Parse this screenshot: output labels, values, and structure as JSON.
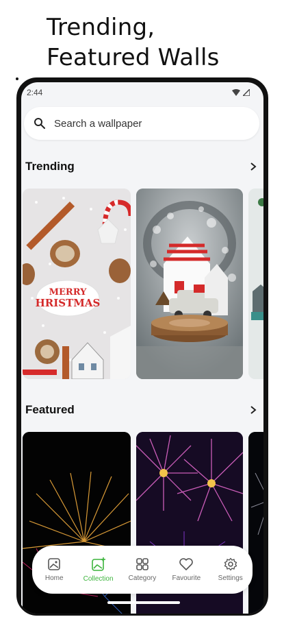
{
  "promo": {
    "line1": "Trending,",
    "line2": "Featured Walls"
  },
  "status": {
    "time": "2:44"
  },
  "search": {
    "placeholder": "Search a wallpaper"
  },
  "sections": {
    "trending": "Trending",
    "featured": "Featured"
  },
  "nav": {
    "items": [
      {
        "label": "Home",
        "icon": "image-icon",
        "active": false
      },
      {
        "label": "Collection",
        "icon": "add-image-icon",
        "active": true
      },
      {
        "label": "Category",
        "icon": "grid-icon",
        "active": false
      },
      {
        "label": "Favourite",
        "icon": "heart-icon",
        "active": false
      },
      {
        "label": "Settings",
        "icon": "gear-icon",
        "active": false
      }
    ]
  },
  "colors": {
    "accent": "#3cb43c",
    "background": "#f4f5f7"
  }
}
